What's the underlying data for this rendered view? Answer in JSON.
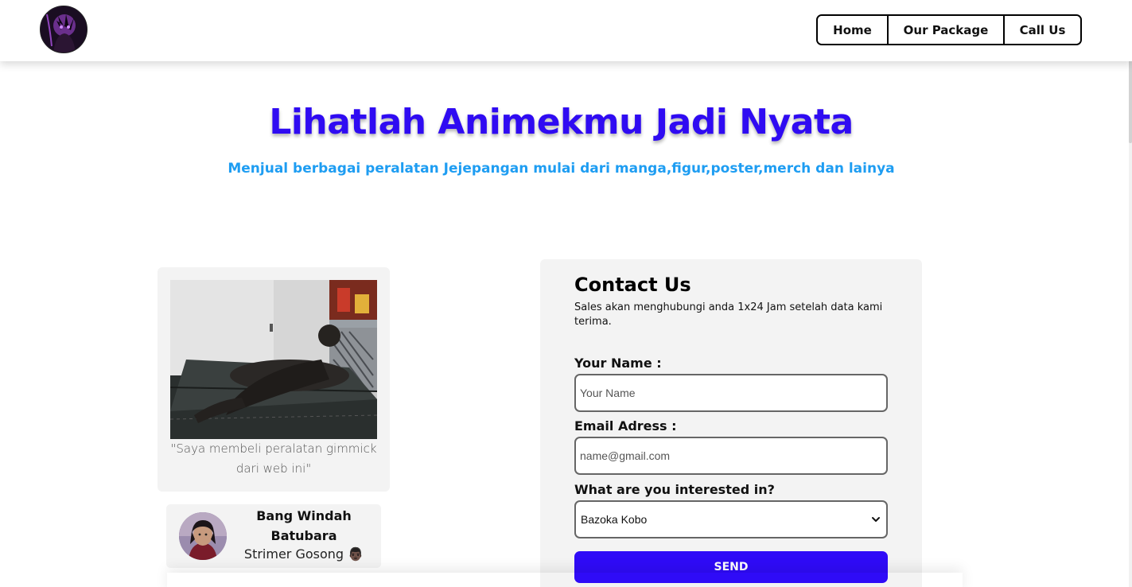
{
  "nav": {
    "logo_icon": "anime-avatar-logo",
    "items": [
      {
        "label": "Home"
      },
      {
        "label": "Our Package"
      },
      {
        "label": "Call Us"
      }
    ]
  },
  "hero": {
    "title": "Lihatlah Animekmu Jadi Nyata",
    "subtitle": "Menjual berbagai peralatan Jejepangan mulai dari manga,figur,poster,merch dan lainya"
  },
  "testimonial": {
    "quote": "\"Saya membeli peralatan gimmick dari web ini\"",
    "author_name": "Bang Windah Batubara",
    "author_role": "Strimer Gosong",
    "author_emoji": "👨🏿"
  },
  "contact": {
    "title": "Contact Us",
    "description": "Sales akan menghubungi anda 1x24 Jam setelah data kami terima.",
    "name_label": "Your Name :",
    "name_placeholder": "Your Name",
    "email_label": "Email Adress :",
    "email_placeholder": "name@gmail.com",
    "interest_label": "What are you interested in?",
    "interest_selected": "Bazoka Kobo",
    "send_label": "SEND"
  },
  "colors": {
    "title": "#2f0bf2",
    "subtitle": "#1e9df2",
    "send_button": "#2f0bf7",
    "card_bg": "#f3f3f3"
  }
}
